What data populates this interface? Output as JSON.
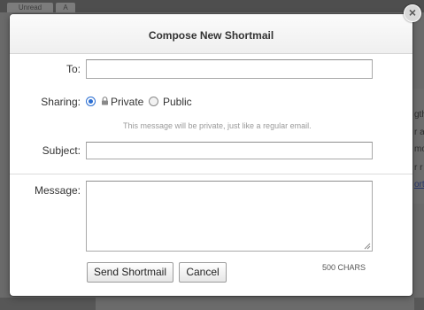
{
  "background": {
    "tabs": [
      "Unread",
      "A"
    ],
    "fragments": [
      "gth",
      "r a",
      "mo",
      "r r",
      "ort"
    ]
  },
  "dialog": {
    "title": "Compose New Shortmail",
    "close_icon": "close-icon",
    "to": {
      "label": "To:",
      "value": ""
    },
    "sharing": {
      "label": "Sharing:",
      "options": [
        {
          "label": "Private",
          "selected": true,
          "icon": "lock-icon"
        },
        {
          "label": "Public",
          "selected": false
        }
      ],
      "hint": "This message will be private, just like a regular email."
    },
    "subject": {
      "label": "Subject:",
      "value": ""
    },
    "message": {
      "label": "Message:",
      "value": ""
    },
    "buttons": {
      "send": "Send Shortmail",
      "cancel": "Cancel"
    },
    "char_count": "500 CHARS"
  },
  "colors": {
    "overlay": "#6a6a6a",
    "radio_accent": "#2b6ed2",
    "hint_text": "#9a9a9a"
  }
}
